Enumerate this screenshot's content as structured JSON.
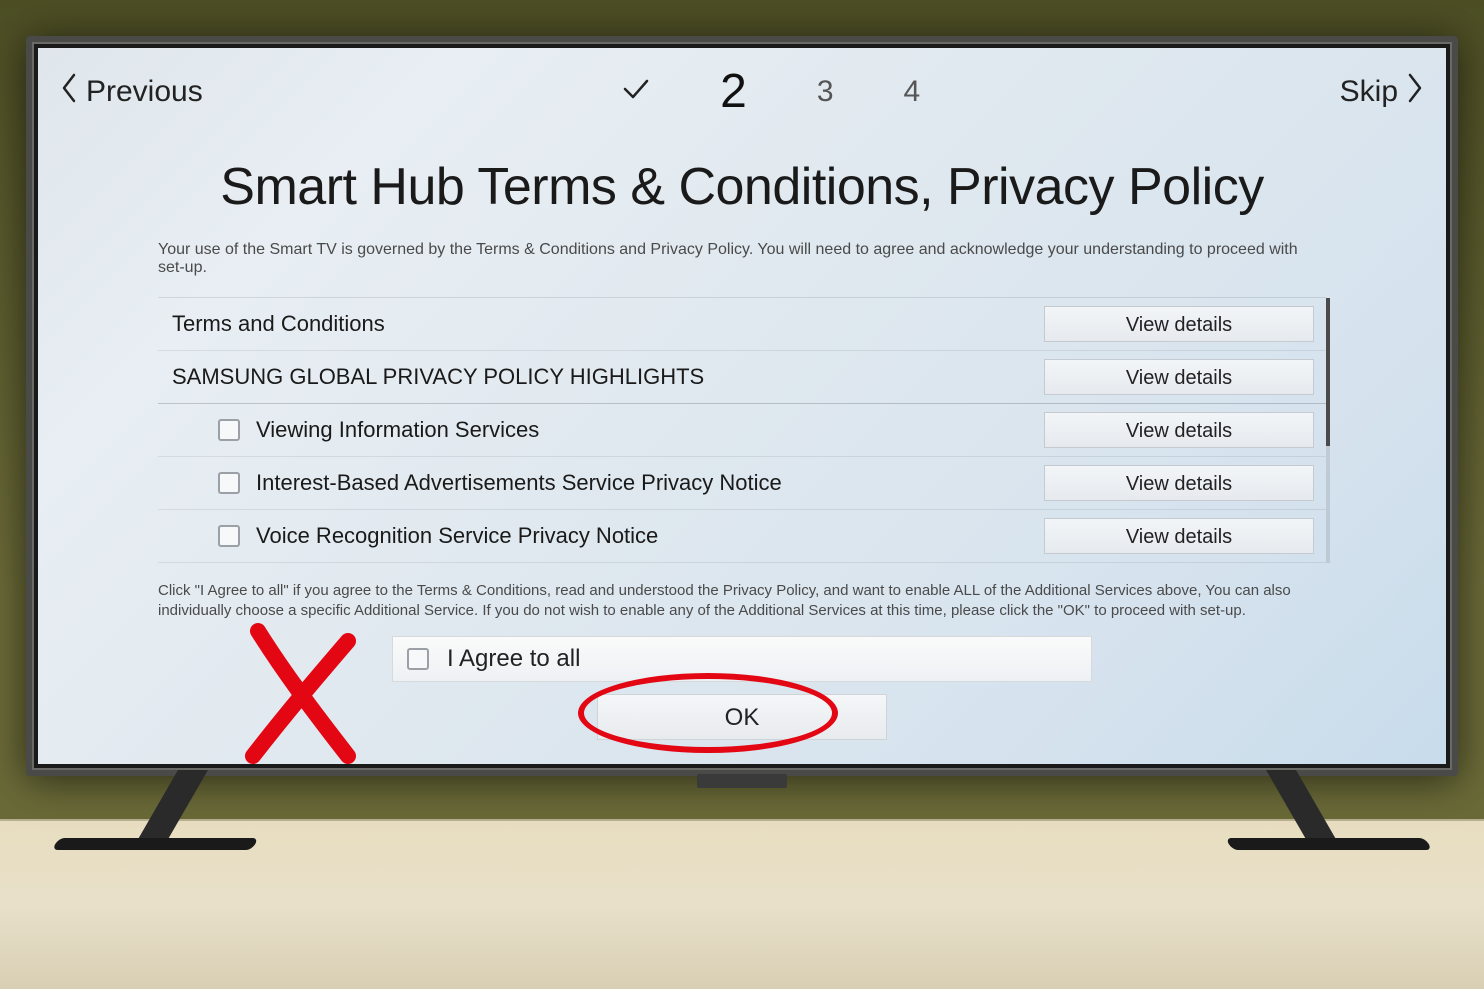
{
  "nav": {
    "previous_label": "Previous",
    "skip_label": "Skip"
  },
  "stepper": {
    "completed_glyph": "✓",
    "current": "2",
    "next1": "3",
    "next2": "4"
  },
  "page": {
    "title": "Smart Hub Terms & Conditions, Privacy Policy",
    "subtitle": "Your use of the Smart TV is governed by the Terms & Conditions and Privacy Policy. You will need to agree and acknowledge your understanding to proceed with set-up."
  },
  "rows": {
    "view_details_label": "View details",
    "items": [
      {
        "label": "Terms and Conditions",
        "checkbox": false
      },
      {
        "label": "SAMSUNG GLOBAL PRIVACY POLICY HIGHLIGHTS",
        "checkbox": false
      },
      {
        "label": "Viewing Information Services",
        "checkbox": true
      },
      {
        "label": "Interest-Based Advertisements Service Privacy Notice",
        "checkbox": true
      },
      {
        "label": "Voice Recognition Service Privacy Notice",
        "checkbox": true
      }
    ]
  },
  "fineprint": "Click \"I Agree to all\" if you agree to the Terms & Conditions, read and understood the Privacy Policy, and want to enable ALL of the Additional Services above, You can also individually choose a specific Additional Service.  If you do not wish to enable any of the Additional Services at this time, please click the \"OK\" to proceed with set-up.",
  "agree_all_label": "I Agree to all",
  "ok_label": "OK",
  "annotation": {
    "red_x": "red-x-mark",
    "red_circle": "red-circle-highlight",
    "color": "#e30613"
  }
}
